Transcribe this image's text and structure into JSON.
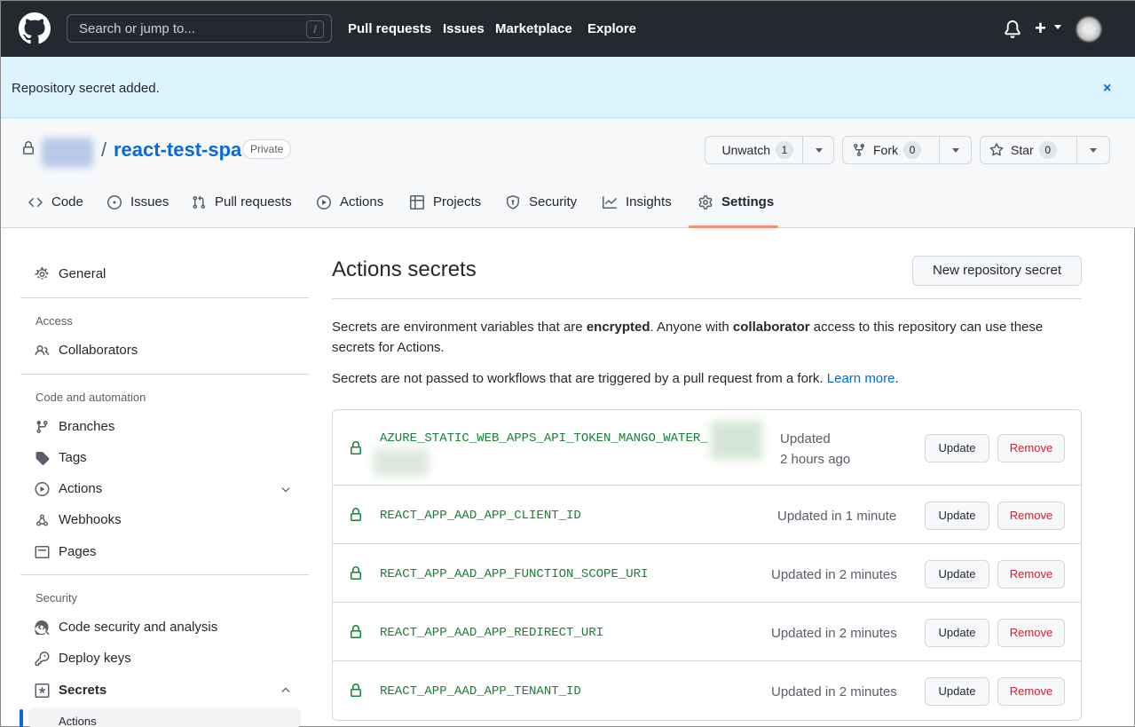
{
  "header": {
    "search_placeholder": "Search or jump to...",
    "search_shortcut": "/",
    "nav": [
      "Pull requests",
      "Issues",
      "Marketplace",
      "Explore"
    ],
    "plus": "+"
  },
  "flash": {
    "message": "Repository secret added.",
    "close": "×"
  },
  "repo": {
    "separator": "/",
    "name": "react-test-spa",
    "visibility": "Private",
    "unwatch_label": "Unwatch",
    "unwatch_count": "1",
    "fork_label": "Fork",
    "fork_count": "0",
    "star_label": "Star",
    "star_count": "0"
  },
  "tabs": [
    "Code",
    "Issues",
    "Pull requests",
    "Actions",
    "Projects",
    "Security",
    "Insights",
    "Settings"
  ],
  "sidebar": {
    "general": "General",
    "access_heading": "Access",
    "collaborators": "Collaborators",
    "code_heading": "Code and automation",
    "branches": "Branches",
    "tags": "Tags",
    "actions": "Actions",
    "webhooks": "Webhooks",
    "pages": "Pages",
    "security_heading": "Security",
    "code_security": "Code security and analysis",
    "deploy_keys": "Deploy keys",
    "secrets": "Secrets",
    "secrets_actions": "Actions"
  },
  "main": {
    "title": "Actions secrets",
    "new_button": "New repository secret",
    "p1_a": "Secrets are environment variables that are ",
    "p1_b": "encrypted",
    "p1_c": ". Anyone with ",
    "p1_d": "collaborator",
    "p1_e": " access to this repository can use these secrets for Actions.",
    "p2_a": "Secrets are not passed to workflows that are triggered by a pull request from a fork. ",
    "p2_link": "Learn more",
    "p2_end": ".",
    "update_label": "Update",
    "remove_label": "Remove",
    "secrets": [
      {
        "name": "AZURE_STATIC_WEB_APPS_API_TOKEN_MANGO_WATER_",
        "updated": "Updated",
        "updated2": "2 hours ago"
      },
      {
        "name": "REACT_APP_AAD_APP_CLIENT_ID",
        "updated": "Updated in 1 minute"
      },
      {
        "name": "REACT_APP_AAD_APP_FUNCTION_SCOPE_URI",
        "updated": "Updated in 2 minutes"
      },
      {
        "name": "REACT_APP_AAD_APP_REDIRECT_URI",
        "updated": "Updated in 2 minutes"
      },
      {
        "name": "REACT_APP_AAD_APP_TENANT_ID",
        "updated": "Updated in 2 minutes"
      }
    ]
  },
  "colors": {
    "header_bg": "#24292f",
    "flash_bg": "#ddf4ff",
    "link": "#0969da",
    "secret_green": "#1a7f37",
    "danger": "#cf222e",
    "tab_underline": "#fd8c73"
  }
}
